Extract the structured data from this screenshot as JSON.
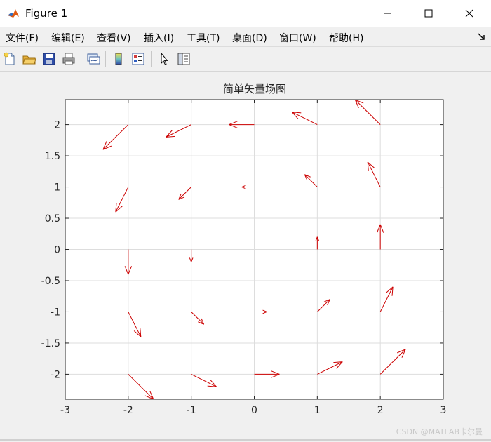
{
  "window": {
    "title": "Figure 1"
  },
  "menu": [
    {
      "label": "文件(F)"
    },
    {
      "label": "编辑(E)"
    },
    {
      "label": "查看(V)"
    },
    {
      "label": "插入(I)"
    },
    {
      "label": "工具(T)"
    },
    {
      "label": "桌面(D)"
    },
    {
      "label": "窗口(W)"
    },
    {
      "label": "帮助(H)"
    }
  ],
  "toolbar": [
    "new-figure",
    "open-file",
    "save",
    "print",
    "link-plot",
    "insert-colorbar",
    "insert-legend",
    "edit-plot",
    "property-inspector"
  ],
  "colors": {
    "arrow": "#cc0000",
    "grid": "#dddddd",
    "axes": "#262626"
  },
  "watermark": "CSDN @MATLAB卡尔曼",
  "chart_data": {
    "type": "quiver",
    "title": "简单矢量场图",
    "xlim": [
      -3,
      3
    ],
    "ylim": [
      -2.4,
      2.4
    ],
    "xticks": [
      -3,
      -2,
      -1,
      0,
      1,
      2,
      3
    ],
    "yticks": [
      -2,
      -1.5,
      -1,
      -0.5,
      0,
      0.5,
      1,
      1.5,
      2
    ],
    "xticklabels": [
      "-3",
      "-2",
      "-1",
      "0",
      "1",
      "2",
      "3"
    ],
    "yticklabels": [
      "-2",
      "-1.5",
      "-1",
      "-0.5",
      "0",
      "0.5",
      "1",
      "1.5",
      "2"
    ],
    "grid": true,
    "vectors": [
      {
        "x": -2,
        "y": 2,
        "u": -0.4,
        "v": -0.4
      },
      {
        "x": -1,
        "y": 2,
        "u": -0.4,
        "v": -0.2
      },
      {
        "x": 0,
        "y": 2,
        "u": -0.4,
        "v": 0
      },
      {
        "x": 1,
        "y": 2,
        "u": -0.4,
        "v": 0.2
      },
      {
        "x": 2,
        "y": 2,
        "u": -0.4,
        "v": 0.4
      },
      {
        "x": -2,
        "y": 1,
        "u": -0.2,
        "v": -0.4
      },
      {
        "x": -1,
        "y": 1,
        "u": -0.2,
        "v": -0.2
      },
      {
        "x": 0,
        "y": 1,
        "u": -0.2,
        "v": 0
      },
      {
        "x": 1,
        "y": 1,
        "u": -0.2,
        "v": 0.2
      },
      {
        "x": 2,
        "y": 1,
        "u": -0.2,
        "v": 0.4
      },
      {
        "x": -2,
        "y": 0,
        "u": 0,
        "v": -0.4
      },
      {
        "x": -1,
        "y": 0,
        "u": 0,
        "v": -0.2
      },
      {
        "x": 0,
        "y": 0,
        "u": 0,
        "v": 0
      },
      {
        "x": 1,
        "y": 0,
        "u": 0,
        "v": 0.2
      },
      {
        "x": 2,
        "y": 0,
        "u": 0,
        "v": 0.4
      },
      {
        "x": -2,
        "y": -1,
        "u": 0.2,
        "v": -0.4
      },
      {
        "x": -1,
        "y": -1,
        "u": 0.2,
        "v": -0.2
      },
      {
        "x": 0,
        "y": -1,
        "u": 0.2,
        "v": 0
      },
      {
        "x": 1,
        "y": -1,
        "u": 0.2,
        "v": 0.2
      },
      {
        "x": 2,
        "y": -1,
        "u": 0.2,
        "v": 0.4
      },
      {
        "x": -2,
        "y": -2,
        "u": 0.4,
        "v": -0.4
      },
      {
        "x": -1,
        "y": -2,
        "u": 0.4,
        "v": -0.2
      },
      {
        "x": 0,
        "y": -2,
        "u": 0.4,
        "v": 0
      },
      {
        "x": 1,
        "y": -2,
        "u": 0.4,
        "v": 0.2
      },
      {
        "x": 2,
        "y": -2,
        "u": 0.4,
        "v": 0.4
      }
    ]
  }
}
